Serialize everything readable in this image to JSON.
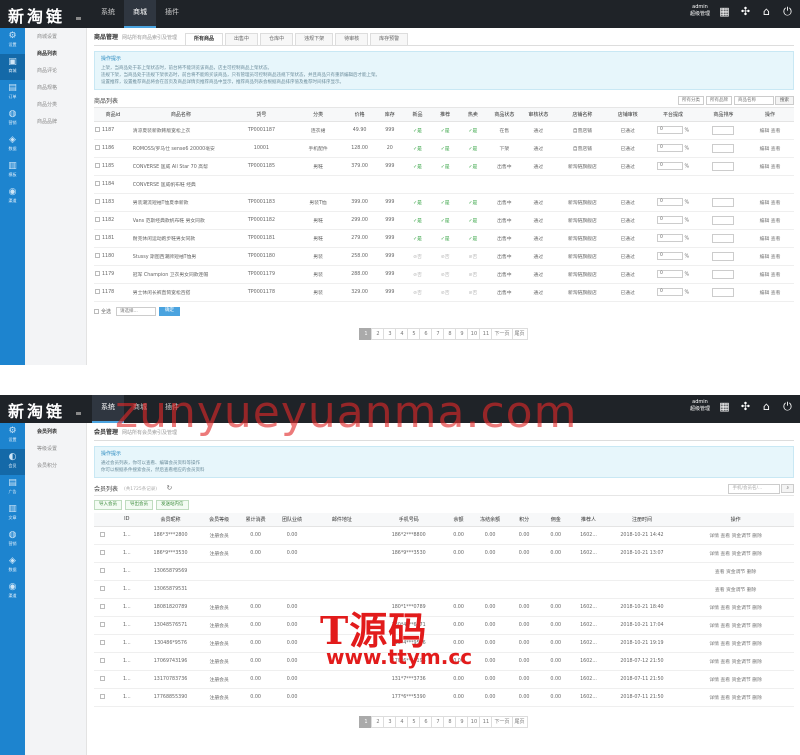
{
  "brand": "新淘链",
  "admin": {
    "name": "admin",
    "role": "超级管理"
  },
  "topnav": [
    "系统",
    "商城",
    "插件"
  ],
  "leftbar": [
    "设置",
    "商城",
    "订单",
    "营销",
    "数据",
    "模板",
    "渠道"
  ],
  "leftbar2": [
    "设置",
    "会员",
    "广告",
    "文章",
    "营销",
    "数据",
    "渠道"
  ],
  "screen1": {
    "subnav": [
      "商城设置",
      "商品列表",
      "商品评论",
      "商品规格",
      "商品分类",
      "商品品牌"
    ],
    "header_title": "商品管理",
    "header_desc": "网站所有商品索引及管理",
    "tabs": [
      "所有商品",
      "出售中",
      "仓库中",
      "违规下架",
      "待审核",
      "库存预警"
    ],
    "tips_title": "操作提示",
    "tips": [
      "上架，当商品处于非上架状态时，前台将不能浏览该商品，店主可控制商品上架状态。",
      "违规下架，当商品处于违规下架状态时，前台将不能购买该商品，只有管理员可控制商品违规下架状态，并且商品只有重新编辑后才能上架。",
      "设置推荐，设置推荐商品将会在首页及商品详情页推荐商品中显示，推荐商品列表会根据商品排序值及推荐时间排序显示。"
    ],
    "list_title": "商品列表",
    "filter_cat": "所有分类",
    "filter_brand": "所有品牌",
    "filter_placeholder": "商品名称",
    "filter_btn": "搜索",
    "columns": [
      "商品id",
      "商品名称",
      "货号",
      "分类",
      "价格",
      "库存",
      "新品",
      "推荐",
      "热卖",
      "商品状态",
      "审核状态",
      "店铺名称",
      "店铺审核",
      "平台提成",
      "商品排序",
      "操作"
    ],
    "rows": [
      [
        "1187",
        "清凉夏装新款韩版宽松上衣",
        "TP0001187",
        "连衣裙",
        "49.90",
        "999",
        "✓是",
        "✓是",
        "✓是",
        "在售",
        "通过",
        "自营店铺",
        "已通过",
        "0",
        "编辑 查看"
      ],
      [
        "1186",
        "ROMOSS/罗马仕 sense6 20000毫安",
        "10001",
        "手机配件",
        "128.00",
        "20",
        "✓是",
        "✓是",
        "✓是",
        "下架",
        "通过",
        "自营店铺",
        "已通过",
        "0",
        "编辑 查看"
      ],
      [
        "1185",
        "CONVERSE 匡威 All Star 70 高帮",
        "TP0001185",
        "男鞋",
        "379.00",
        "999",
        "✓是",
        "✓是",
        "✓是",
        "出售中",
        "通过",
        "新淘链旗舰店",
        "已通过",
        "0",
        "编辑 查看"
      ],
      [
        "1184",
        "CONVERSE 匡威帆布鞋 经典",
        "",
        "",
        "",
        "",
        "",
        "",
        "",
        "",
        "",
        "",
        "",
        "",
        ""
      ],
      [
        "1183",
        "男装潮流短袖T恤夏季新款",
        "TP0001183",
        "男装T恤",
        "399.00",
        "999",
        "✓是",
        "✓是",
        "✓是",
        "出售中",
        "通过",
        "新淘链旗舰店",
        "已通过",
        "0",
        "编辑 查看"
      ],
      [
        "1182",
        "Vans 范斯经典款帆布鞋 男女同款",
        "TP0001182",
        "男鞋",
        "299.00",
        "999",
        "✓是",
        "✓是",
        "✓是",
        "出售中",
        "通过",
        "新淘链旗舰店",
        "已通过",
        "0",
        "编辑 查看"
      ],
      [
        "1181",
        "耐克休闲运动跑步鞋男女同款",
        "TP0001181",
        "男鞋",
        "279.00",
        "999",
        "✓是",
        "✓是",
        "✓是",
        "出售中",
        "通过",
        "新淘链旗舰店",
        "已通过",
        "0",
        "编辑 查看"
      ],
      [
        "1180",
        "Stussy 斯图西潮牌短袖T恤男",
        "TP0001180",
        "男装",
        "258.00",
        "999",
        "⊘否",
        "⊘否",
        "⊘否",
        "出售中",
        "通过",
        "新淘链旗舰店",
        "已通过",
        "0",
        "编辑 查看"
      ],
      [
        "1179",
        "冠军 Champion 卫衣男女同款连帽",
        "TP0001179",
        "男装",
        "288.00",
        "999",
        "⊘否",
        "⊘否",
        "⊘否",
        "出售中",
        "通过",
        "新淘链旗舰店",
        "已通过",
        "0",
        "编辑 查看"
      ],
      [
        "1178",
        "男士休闲长裤直筒宽松百搭",
        "TP0001178",
        "男装",
        "329.00",
        "999",
        "⊘否",
        "⊘否",
        "⊘否",
        "出售中",
        "通过",
        "新淘链旗舰店",
        "已通过",
        "0",
        "编辑 查看"
      ]
    ],
    "bulk_label": "全选",
    "bulk_select": "请选择...",
    "bulk_go": "确定",
    "pager": [
      "1",
      "2",
      "3",
      "4",
      "5",
      "6",
      "7",
      "8",
      "9",
      "10",
      "11",
      "下一页",
      "尾页"
    ]
  },
  "screen2": {
    "subnav": [
      "会员列表",
      "等级设置",
      "会员积分"
    ],
    "header_title": "会员管理",
    "header_desc": "网站所有会员索引及管理",
    "tips_title": "操作提示",
    "tips": [
      "通过会员列表，你可以查看、编辑会员资料等操作",
      "你可以根据条件搜索会员，然后查看相应的会员资料"
    ],
    "list_title": "会员列表",
    "list_sub": "(共1725条记录)",
    "search_placeholder": "手机/会员名/...",
    "toolbar": [
      "导入会员",
      "导出会员",
      "发送站内信"
    ],
    "columns": [
      "",
      "ID",
      "会员昵称",
      "会员等级",
      "累计消费",
      "团队业绩",
      "邮件地址",
      "手机号码",
      "余额",
      "冻结余额",
      "积分",
      "佣金",
      "推荐人",
      "注册时间",
      "操作"
    ],
    "rows": [
      [
        "",
        "1...",
        "186*3***2800",
        "注册会员",
        "0.00",
        "0.00",
        "",
        "186*2***8800",
        "0.00",
        "0.00",
        "0.00",
        "0.00",
        "1602...",
        "2018-10-21 14:42",
        "详情 查看 资金调节 删除"
      ],
      [
        "",
        "1...",
        "186*9***3530",
        "注册会员",
        "0.00",
        "0.00",
        "",
        "186*9***3530",
        "0.00",
        "0.00",
        "0.00",
        "0.00",
        "1602...",
        "2018-10-21 13:07",
        "详情 查看 资金调节 删除"
      ],
      [
        "",
        "1...",
        "13065879569",
        "",
        "",
        "",
        "",
        "",
        "",
        "",
        "",
        "",
        "",
        "",
        "查看 资金调节 删除"
      ],
      [
        "",
        "1...",
        "13065879531",
        "",
        "",
        "",
        "",
        "",
        "",
        "",
        "",
        "",
        "",
        "",
        "查看 资金调节 删除"
      ],
      [
        "",
        "1...",
        "18081820789",
        "注册会员",
        "0.00",
        "0.00",
        "",
        "180*1***0789",
        "0.00",
        "0.00",
        "0.00",
        "0.00",
        "1602...",
        "2018-10-21 18:40",
        "详情 查看 资金调节 删除"
      ],
      [
        "",
        "1...",
        "13048576571",
        "注册会员",
        "0.00",
        "0.00",
        "",
        "130*4***6571",
        "0.00",
        "0.00",
        "0.00",
        "0.00",
        "1602...",
        "2018-10-21 17:04",
        "详情 查看 资金调节 删除"
      ],
      [
        "",
        "1...",
        "130486*9576",
        "注册会员",
        "0.00",
        "0.00",
        "",
        "130*4***9576",
        "0.00",
        "0.00",
        "0.00",
        "0.00",
        "1602...",
        "2018-10-21 19:19",
        "详情 查看 资金调节 删除"
      ],
      [
        "",
        "1...",
        "17069743196",
        "注册会员",
        "0.00",
        "0.00",
        "",
        "170*6***3196",
        "0.00",
        "0.00",
        "0.00",
        "0.00",
        "1602...",
        "2018-07-12 21:50",
        "详情 查看 资金调节 删除"
      ],
      [
        "",
        "1...",
        "13170783736",
        "注册会员",
        "0.00",
        "0.00",
        "",
        "131*7***3736",
        "0.00",
        "0.00",
        "0.00",
        "0.00",
        "1602...",
        "2018-07-11 21:50",
        "详情 查看 资金调节 删除"
      ],
      [
        "",
        "1...",
        "17768855390",
        "注册会员",
        "0.00",
        "0.00",
        "",
        "177*6***5390",
        "0.00",
        "0.00",
        "0.00",
        "0.00",
        "1602...",
        "2018-07-11 21:50",
        "详情 查看 资金调节 删除"
      ]
    ],
    "pager": [
      "1",
      "2",
      "3",
      "4",
      "5",
      "6",
      "7",
      "8",
      "9",
      "10",
      "11",
      "下一页",
      "尾页"
    ]
  },
  "watermark": {
    "big": "zunyueyuanma.com",
    "zh": "T源码",
    "url": "www.ttym.cc"
  }
}
